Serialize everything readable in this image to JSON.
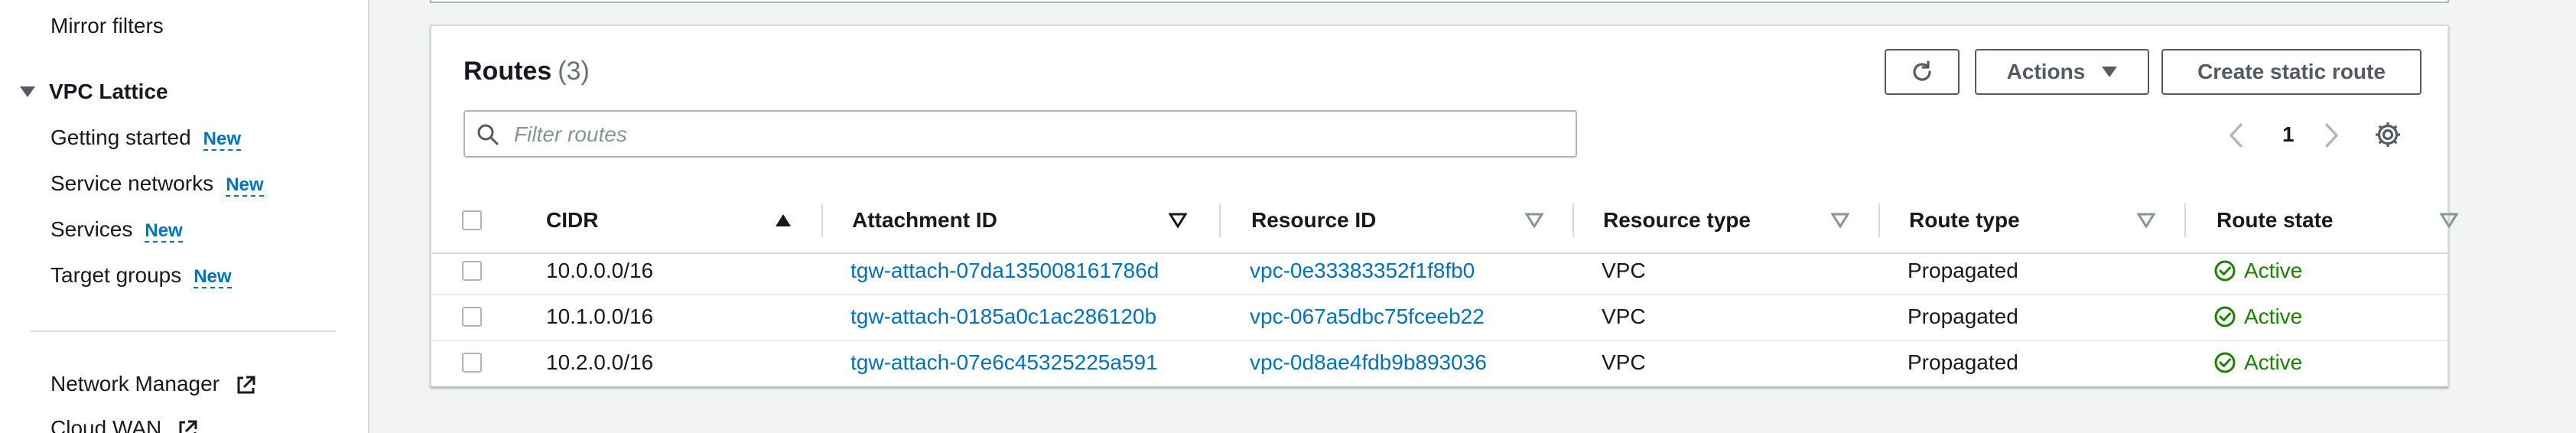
{
  "sidebar": {
    "mirror_filters": "Mirror filters",
    "section_title": "VPC Lattice",
    "items": [
      {
        "label": "Getting started",
        "badge": "New"
      },
      {
        "label": "Service networks",
        "badge": "New"
      },
      {
        "label": "Services",
        "badge": "New"
      },
      {
        "label": "Target groups",
        "badge": "New"
      }
    ],
    "network_manager": "Network Manager",
    "cloud_wan": "Cloud WAN"
  },
  "routes_panel": {
    "title": "Routes",
    "count": "(3)",
    "actions_label": "Actions",
    "create_label": "Create static route",
    "filter_placeholder": "Filter routes",
    "filter_value": "",
    "page_number": "1",
    "columns": [
      "CIDR",
      "Attachment ID",
      "Resource ID",
      "Resource type",
      "Route type",
      "Route state"
    ],
    "rows": [
      {
        "cidr": "10.0.0.0/16",
        "attachment_id": "tgw-attach-07da135008161786d",
        "resource_id": "vpc-0e33383352f1f8fb0",
        "resource_type": "VPC",
        "route_type": "Propagated",
        "route_state": "Active"
      },
      {
        "cidr": "10.1.0.0/16",
        "attachment_id": "tgw-attach-0185a0c1ac286120b",
        "resource_id": "vpc-067a5dbc75fceeb22",
        "resource_type": "VPC",
        "route_type": "Propagated",
        "route_state": "Active"
      },
      {
        "cidr": "10.2.0.0/16",
        "attachment_id": "tgw-attach-07e6c45325225a591",
        "resource_id": "vpc-0d8ae4fdb9b893036",
        "resource_type": "VPC",
        "route_type": "Propagated",
        "route_state": "Active"
      }
    ]
  },
  "icons": {
    "refresh": "refresh-icon",
    "search": "search-icon",
    "settings": "settings-gear-icon",
    "status": "check-circle-icon",
    "external": "external-link-icon"
  },
  "colors": {
    "link": "#0073bb",
    "success": "#1d8102",
    "border": "#d5dbdb"
  }
}
